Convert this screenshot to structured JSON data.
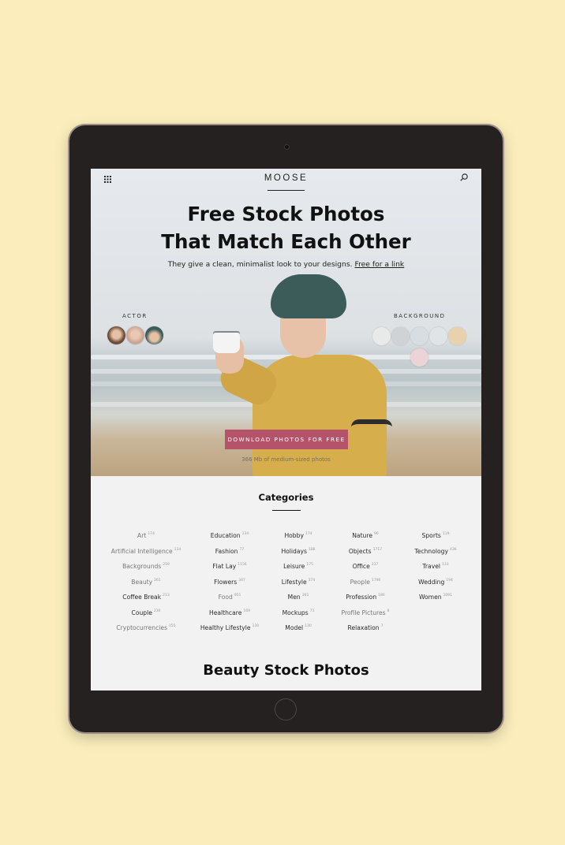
{
  "header": {
    "brand": "MOOSE",
    "grid_icon": "grid-icon",
    "search_icon": "search-icon"
  },
  "hero": {
    "title_line1": "Free Stock Photos",
    "title_line2": "That Match Each Other",
    "subtitle": "They give a clean, minimalist look to your designs. ",
    "subtitle_link": "Free for a link",
    "actor_label": "ACTOR",
    "background_label": "BACKGROUND",
    "cta_label": "DOWNLOAD PHOTOS FOR FREE",
    "cta_note": "366 Mb of medium-sized photos",
    "colors": {
      "cta": "#b5536a",
      "page_bg": "#fbeebc"
    }
  },
  "categories": {
    "title": "Categories",
    "columns": [
      [
        {
          "name": "Art",
          "count": "174",
          "muted": true
        },
        {
          "name": "Artificial Intelligence",
          "count": "134",
          "muted": true
        },
        {
          "name": "Backgrounds",
          "count": "259",
          "muted": true
        },
        {
          "name": "Beauty",
          "count": "261",
          "muted": true
        },
        {
          "name": "Coffee Break",
          "count": "213",
          "muted": false
        },
        {
          "name": "Couple",
          "count": "230",
          "muted": false
        },
        {
          "name": "Cryptocurrencies",
          "count": "155",
          "muted": true
        }
      ],
      [
        {
          "name": "Education",
          "count": "134",
          "muted": false
        },
        {
          "name": "Fashion",
          "count": "77",
          "muted": false
        },
        {
          "name": "Flat Lay",
          "count": "1156",
          "muted": false
        },
        {
          "name": "Flowers",
          "count": "347",
          "muted": false
        },
        {
          "name": "Food",
          "count": "951",
          "muted": true
        },
        {
          "name": "Healthcare",
          "count": "169",
          "muted": false
        },
        {
          "name": "Healthy Lifestyle",
          "count": "130",
          "muted": false
        }
      ],
      [
        {
          "name": "Hobby",
          "count": "174",
          "muted": false
        },
        {
          "name": "Holidays",
          "count": "188",
          "muted": false
        },
        {
          "name": "Leisure",
          "count": "175",
          "muted": false
        },
        {
          "name": "Lifestyle",
          "count": "374",
          "muted": false
        },
        {
          "name": "Men",
          "count": "361",
          "muted": false
        },
        {
          "name": "Mockups",
          "count": "71",
          "muted": false
        },
        {
          "name": "Model",
          "count": "130",
          "muted": false
        }
      ],
      [
        {
          "name": "Nature",
          "count": "96",
          "muted": false
        },
        {
          "name": "Objects",
          "count": "1717",
          "muted": false
        },
        {
          "name": "Office",
          "count": "237",
          "muted": false
        },
        {
          "name": "People",
          "count": "1796",
          "muted": true
        },
        {
          "name": "Profession",
          "count": "186",
          "muted": false
        },
        {
          "name": "Profile Pictures",
          "count": "8",
          "muted": true
        },
        {
          "name": "Relaxation",
          "count": "7",
          "muted": false
        }
      ],
      [
        {
          "name": "Sports",
          "count": "119",
          "muted": false
        },
        {
          "name": "Technology",
          "count": "436",
          "muted": false
        },
        {
          "name": "Travel",
          "count": "133",
          "muted": false
        },
        {
          "name": "Wedding",
          "count": "194",
          "muted": false
        },
        {
          "name": "Women",
          "count": "1091",
          "muted": false
        }
      ]
    ]
  },
  "section": {
    "title": "Beauty Stock Photos"
  }
}
